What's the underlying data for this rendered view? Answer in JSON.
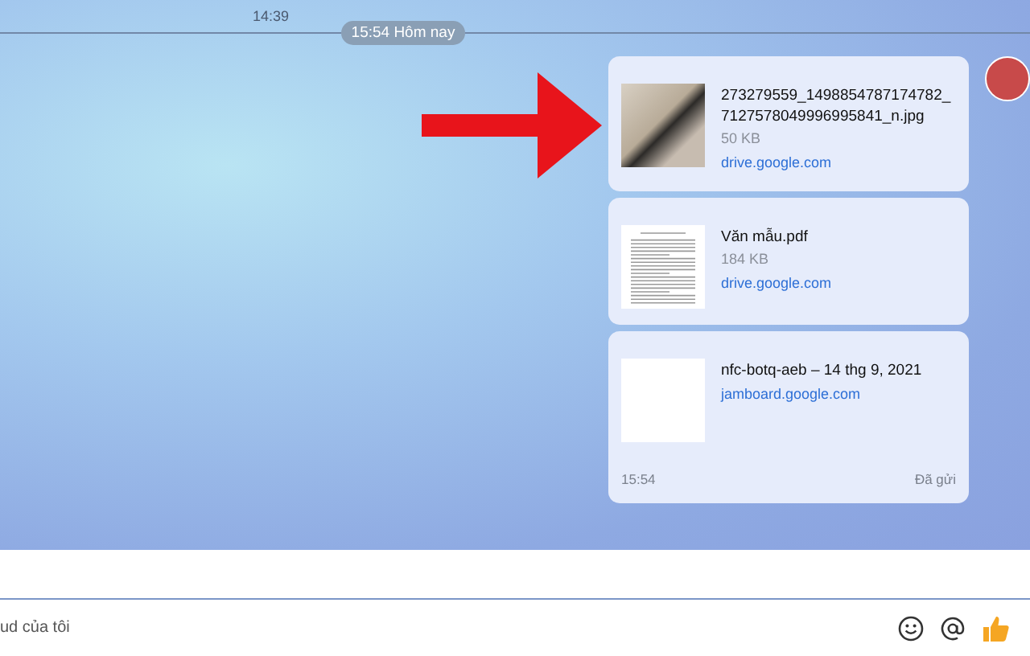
{
  "previous_time": "14:39",
  "divider": {
    "label": "15:54 Hôm nay"
  },
  "message": {
    "files": [
      {
        "kind": "photo",
        "name": "273279559_1498854787174782_7127578049996995841_n.jpg",
        "size": "50 KB",
        "source": "drive.google.com"
      },
      {
        "kind": "document",
        "name": "Văn mẫu.pdf",
        "size": "184 KB",
        "source": "drive.google.com"
      },
      {
        "kind": "blank",
        "name": "nfc-botq-aeb – 14 thg 9, 2021",
        "source": "jamboard.google.com"
      }
    ],
    "time": "15:54",
    "status": "Đã gửi"
  },
  "composer": {
    "placeholder": "ud của tôi"
  }
}
